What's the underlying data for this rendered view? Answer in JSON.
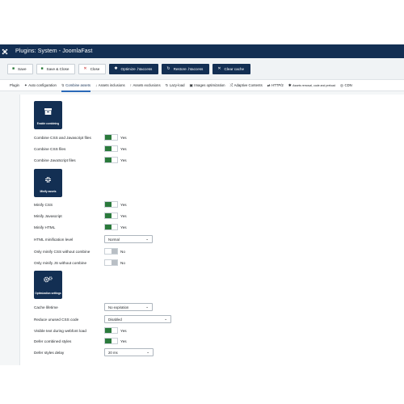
{
  "header": {
    "title": "Plugins: System - JoomlaFast",
    "logo_icon": "joomla-logo-icon"
  },
  "toolbar": {
    "save": "Save",
    "save_close": "Save & Close",
    "close": "Close",
    "optimize_htaccess": "Optimize .htaccess",
    "restore_htaccess": "Restore .htaccess",
    "clear_cache": "Clear cache"
  },
  "tabs": [
    {
      "label": "Plugin",
      "icon": ""
    },
    {
      "label": "Auto configuration",
      "icon": "wand-icon"
    },
    {
      "label": "Combine assets",
      "icon": "bolt-icon"
    },
    {
      "label": "Assets inclusions",
      "icon": "download-icon"
    },
    {
      "label": "Assets exclusions",
      "icon": "upload-icon"
    },
    {
      "label": "Lazy-load",
      "icon": "refresh-icon"
    },
    {
      "label": "Images optimization",
      "icon": "image-icon"
    },
    {
      "label": "Adaptive Contents",
      "icon": "shuffle-icon"
    },
    {
      "label": "HTTP/2",
      "icon": "sync-icon"
    },
    {
      "label": "Assets removal, code and preload",
      "icon": "gear-icon"
    },
    {
      "label": "CDN",
      "icon": "globe-icon"
    }
  ],
  "sections": {
    "enable_combining": "Enable combining",
    "minify_assets": "Minify assets",
    "optimization_settings": "Optimization settings"
  },
  "fields": {
    "combine_css_js": {
      "label": "Combine CSS and Javascript files",
      "value": "Yes"
    },
    "combine_css": {
      "label": "Combine CSS files",
      "value": "Yes"
    },
    "combine_js": {
      "label": "Combine JavaScript files",
      "value": "Yes"
    },
    "minify_css": {
      "label": "Minify CSS",
      "value": "Yes"
    },
    "minify_js": {
      "label": "Minify Javascript",
      "value": "Yes"
    },
    "minify_html": {
      "label": "Minify HTML",
      "value": "Yes"
    },
    "html_minification_level": {
      "label": "HTML minification level",
      "value": "Normal"
    },
    "only_minify_css": {
      "label": "Only minify CSS without combine",
      "value": "No"
    },
    "only_minify_js": {
      "label": "Only minify JS without combine",
      "value": "No"
    },
    "cache_lifetime": {
      "label": "Cache lifetime",
      "value": "No expiration"
    },
    "reduce_unused_css": {
      "label": "Reduce unused CSS code",
      "value": "Disabled"
    },
    "visible_text_webfont": {
      "label": "Visible text during webfont load",
      "value": "Yes"
    },
    "defer_combined_styles": {
      "label": "Defer combined styles",
      "value": "Yes"
    },
    "defer_styles_delay": {
      "label": "Defer styles delay",
      "value": "20 ms"
    }
  },
  "colors": {
    "brand_dark": "#132f53",
    "toggle_on": "#2a7a3b",
    "tab_underline": "#2a69b8"
  }
}
